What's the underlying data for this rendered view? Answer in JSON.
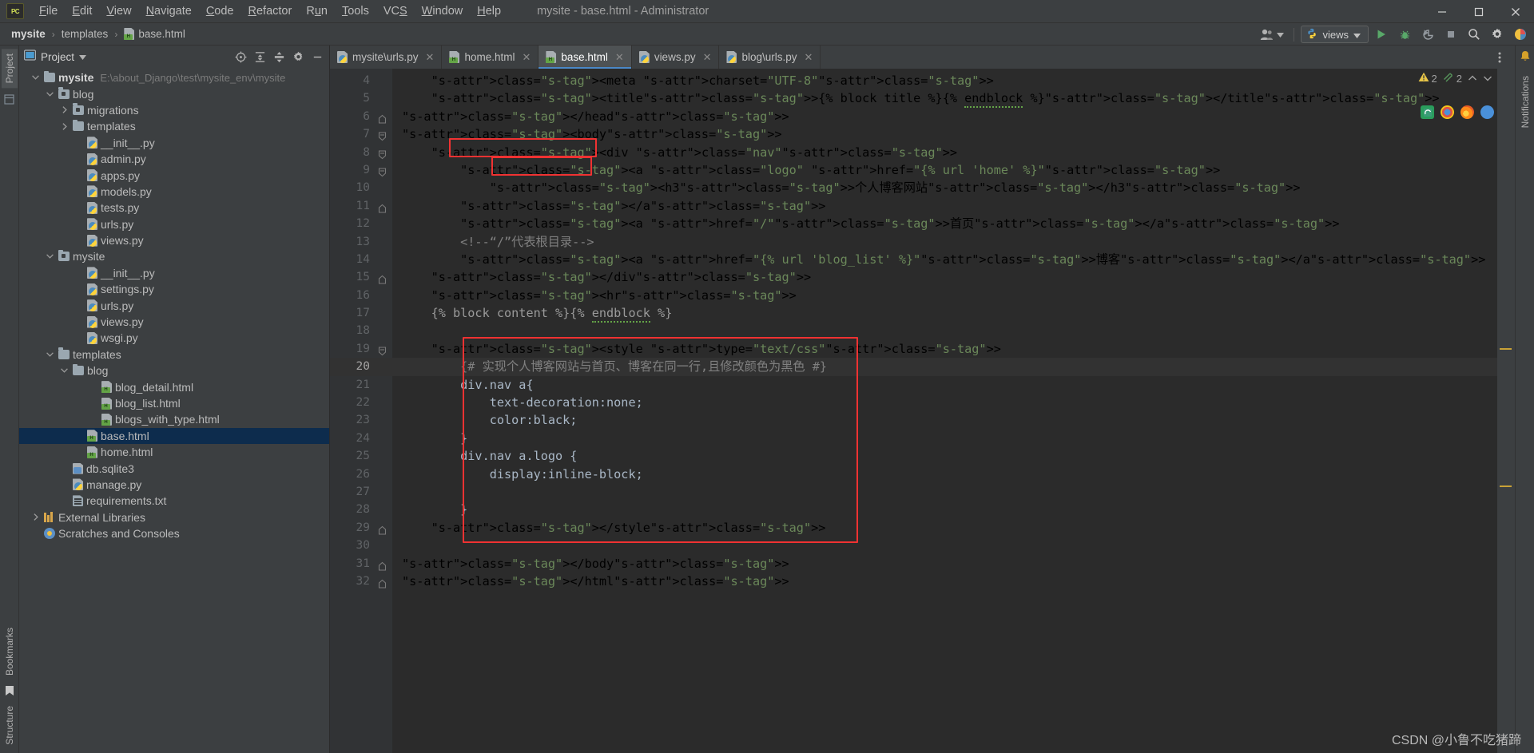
{
  "window": {
    "title": "mysite - base.html - Administrator",
    "logo": "pycharm-logo",
    "controls": {
      "minimize": "–",
      "maximize": "❐",
      "close": "✕"
    }
  },
  "menubar": [
    {
      "label": "File",
      "accel": "F"
    },
    {
      "label": "Edit",
      "accel": "E"
    },
    {
      "label": "View",
      "accel": "V"
    },
    {
      "label": "Navigate",
      "accel": "N"
    },
    {
      "label": "Code",
      "accel": "C"
    },
    {
      "label": "Refactor",
      "accel": "R"
    },
    {
      "label": "Run",
      "accel": "u"
    },
    {
      "label": "Tools",
      "accel": "T"
    },
    {
      "label": "VCS",
      "accel": "S"
    },
    {
      "label": "Window",
      "accel": "W"
    },
    {
      "label": "Help",
      "accel": "H"
    }
  ],
  "breadcrumb": {
    "items": [
      "mysite",
      "templates",
      "base.html"
    ],
    "separator": "›"
  },
  "toolbar": {
    "run_config": "views",
    "run_config_icon": "python-icon",
    "buttons": [
      "run-button",
      "debug-button",
      "coverage-button",
      "stop-button",
      "search-everywhere-button",
      "settings-button",
      "jetbrains-toolbox-button"
    ],
    "account_icon": "user-account-icon"
  },
  "left_strip": {
    "top": [
      "Project"
    ],
    "bottom": [
      "Bookmarks",
      "Structure"
    ]
  },
  "right_strip": {
    "items": [
      "Notifications"
    ]
  },
  "project_panel": {
    "title": "Project",
    "header_icons": [
      "locate-icon",
      "expand-all-icon",
      "collapse-all-icon",
      "settings-icon",
      "hide-icon"
    ],
    "tree": [
      {
        "label": "mysite",
        "path": "E:\\about_Django\\test\\mysite_env\\mysite",
        "indent": 0,
        "arrow": "down",
        "icon": "folder",
        "bold": true
      },
      {
        "label": "blog",
        "indent": 1,
        "arrow": "down",
        "icon": "folder-module"
      },
      {
        "label": "migrations",
        "indent": 2,
        "arrow": "right",
        "icon": "folder-module"
      },
      {
        "label": "templates",
        "indent": 2,
        "arrow": "right",
        "icon": "folder"
      },
      {
        "label": "__init__.py",
        "indent": 3,
        "arrow": "",
        "icon": "python"
      },
      {
        "label": "admin.py",
        "indent": 3,
        "arrow": "",
        "icon": "python"
      },
      {
        "label": "apps.py",
        "indent": 3,
        "arrow": "",
        "icon": "python"
      },
      {
        "label": "models.py",
        "indent": 3,
        "arrow": "",
        "icon": "python"
      },
      {
        "label": "tests.py",
        "indent": 3,
        "arrow": "",
        "icon": "python"
      },
      {
        "label": "urls.py",
        "indent": 3,
        "arrow": "",
        "icon": "python"
      },
      {
        "label": "views.py",
        "indent": 3,
        "arrow": "",
        "icon": "python"
      },
      {
        "label": "mysite",
        "indent": 1,
        "arrow": "down",
        "icon": "folder-module"
      },
      {
        "label": "__init__.py",
        "indent": 3,
        "arrow": "",
        "icon": "python"
      },
      {
        "label": "settings.py",
        "indent": 3,
        "arrow": "",
        "icon": "python"
      },
      {
        "label": "urls.py",
        "indent": 3,
        "arrow": "",
        "icon": "python"
      },
      {
        "label": "views.py",
        "indent": 3,
        "arrow": "",
        "icon": "python"
      },
      {
        "label": "wsgi.py",
        "indent": 3,
        "arrow": "",
        "icon": "python"
      },
      {
        "label": "templates",
        "indent": 1,
        "arrow": "down",
        "icon": "folder"
      },
      {
        "label": "blog",
        "indent": 2,
        "arrow": "down",
        "icon": "folder"
      },
      {
        "label": "blog_detail.html",
        "indent": 4,
        "arrow": "",
        "icon": "html"
      },
      {
        "label": "blog_list.html",
        "indent": 4,
        "arrow": "",
        "icon": "html"
      },
      {
        "label": "blogs_with_type.html",
        "indent": 4,
        "arrow": "",
        "icon": "html"
      },
      {
        "label": "base.html",
        "indent": 3,
        "arrow": "",
        "icon": "html",
        "selected": true
      },
      {
        "label": "home.html",
        "indent": 3,
        "arrow": "",
        "icon": "html"
      },
      {
        "label": "db.sqlite3",
        "indent": 2,
        "arrow": "",
        "icon": "db"
      },
      {
        "label": "manage.py",
        "indent": 2,
        "arrow": "",
        "icon": "python"
      },
      {
        "label": "requirements.txt",
        "indent": 2,
        "arrow": "",
        "icon": "txt"
      },
      {
        "label": "External Libraries",
        "indent": 0,
        "arrow": "right",
        "icon": "library"
      },
      {
        "label": "Scratches and Consoles",
        "indent": 0,
        "arrow": "",
        "icon": "scratch"
      }
    ]
  },
  "editor_tabs": [
    {
      "label": "mysite\\urls.py",
      "icon": "python",
      "active": false
    },
    {
      "label": "home.html",
      "icon": "html",
      "active": false
    },
    {
      "label": "base.html",
      "icon": "html",
      "active": true
    },
    {
      "label": "views.py",
      "icon": "python",
      "active": false
    },
    {
      "label": "blog\\urls.py",
      "icon": "python",
      "active": false
    }
  ],
  "inspection": {
    "warnings": "2",
    "weak_warnings": "2",
    "warning_icon": "warning-triangle-icon",
    "weak_warning_icon": "weak-warning-icon",
    "up_arrow": "⌃",
    "down_arrow": "⌄"
  },
  "browser_preview_icons": [
    "edge-icon",
    "chrome-icon",
    "firefox-icon",
    "opera-icon"
  ],
  "editor": {
    "first_line": 4,
    "current_line": 20,
    "lines": [
      {
        "n": 4,
        "text": "    <meta charset=\"UTF-8\">"
      },
      {
        "n": 5,
        "text": "    <title>{% block title %}{% endblock %}</title>"
      },
      {
        "n": 6,
        "text": "</head>",
        "fold": "end"
      },
      {
        "n": 7,
        "text": "<body>",
        "fold": "start"
      },
      {
        "n": 8,
        "text": "    <div class=\"nav\">",
        "fold": "start"
      },
      {
        "n": 9,
        "text": "        <a class=\"logo\" href=\"{% url 'home' %}\">",
        "fold": "start"
      },
      {
        "n": 10,
        "text": "            <h3>个人博客网站</h3>"
      },
      {
        "n": 11,
        "text": "        </a>",
        "fold": "end"
      },
      {
        "n": 12,
        "text": "        <a href=\"/\">首页</a>"
      },
      {
        "n": 13,
        "text": "        <!--“/”代表根目录-->"
      },
      {
        "n": 14,
        "text": "        <a href=\"{% url 'blog_list' %}\">博客</a>"
      },
      {
        "n": 15,
        "text": "    </div>",
        "fold": "end"
      },
      {
        "n": 16,
        "text": "    <hr>"
      },
      {
        "n": 17,
        "text": "    {% block content %}{% endblock %}"
      },
      {
        "n": 18,
        "text": ""
      },
      {
        "n": 19,
        "text": "    <style type=\"text/css\">",
        "fold": "start"
      },
      {
        "n": 20,
        "text": "        {# 实现个人博客网站与首页、博客在同一行,且修改颜色为黑色 #}"
      },
      {
        "n": 21,
        "text": "        div.nav a{"
      },
      {
        "n": 22,
        "text": "            text-decoration:none;"
      },
      {
        "n": 23,
        "text": "            color:black;"
      },
      {
        "n": 24,
        "text": "        }"
      },
      {
        "n": 25,
        "text": "        div.nav a.logo {"
      },
      {
        "n": 26,
        "text": "            display:inline-block;"
      },
      {
        "n": 27,
        "text": ""
      },
      {
        "n": 28,
        "text": "        }"
      },
      {
        "n": 29,
        "text": "    </style>",
        "fold": "end"
      },
      {
        "n": 30,
        "text": ""
      },
      {
        "n": 31,
        "text": "</body>",
        "fold": "end"
      },
      {
        "n": 32,
        "text": "</html>",
        "fold": "end"
      }
    ],
    "annotations": [
      {
        "name": "div-nav-highlight",
        "label": "<div class=\"nav\">"
      },
      {
        "name": "a-logo-highlight",
        "label": "<a class=\"logo\""
      },
      {
        "name": "style-block-highlight",
        "label": "style block"
      }
    ]
  },
  "watermark": "CSDN @小鲁不吃猪蹄",
  "colors": {
    "accent": "#4a88c7",
    "selection": "#0d2c4d",
    "annotation": "#f03232",
    "editor_bg": "#2b2b2b",
    "panel_bg": "#3c3f41",
    "string": "#6a8759",
    "tag": "#e8bf6a",
    "text": "#a9b7c6",
    "comment": "#808080"
  }
}
